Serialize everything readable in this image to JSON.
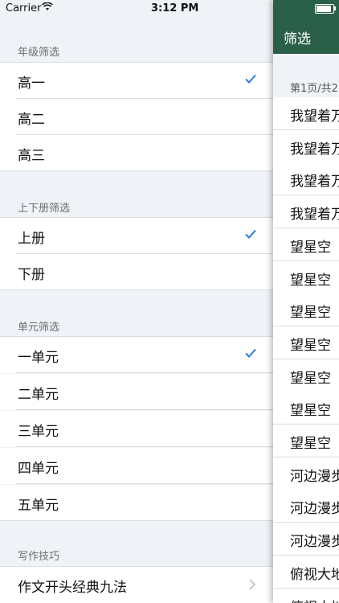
{
  "status_bar": {
    "carrier": "Carrier",
    "time": "3:12 PM"
  },
  "filter": {
    "sections": [
      {
        "header": "年级筛选",
        "items": [
          {
            "label": "高一",
            "checked": true
          },
          {
            "label": "高二",
            "checked": false
          },
          {
            "label": "高三",
            "checked": false
          }
        ]
      },
      {
        "header": "上下册筛选",
        "items": [
          {
            "label": "上册",
            "checked": true
          },
          {
            "label": "下册",
            "checked": false
          }
        ]
      },
      {
        "header": "单元筛选",
        "items": [
          {
            "label": "一单元",
            "checked": true
          },
          {
            "label": "二单元",
            "checked": false
          },
          {
            "label": "三单元",
            "checked": false
          },
          {
            "label": "四单元",
            "checked": false
          },
          {
            "label": "五单元",
            "checked": false
          }
        ]
      },
      {
        "header": "写作技巧",
        "items": [
          {
            "label": "作文开头经典九法",
            "checked": false
          }
        ]
      }
    ]
  },
  "main": {
    "nav_title": "筛选",
    "page_info": "第1页/共2",
    "items": [
      "我望着万",
      "我望着万",
      "我望着万",
      "我望着万",
      "望星空",
      "望星空",
      "望星空",
      "望星空",
      "望星空",
      "望星空",
      "望星空",
      "河边漫步",
      "河边漫步",
      "河边漫步",
      "俯视大地",
      "俯视大地"
    ]
  },
  "colors": {
    "accent_check": "#2f7bd9",
    "navbar_green": "#2a6049",
    "group_bg": "#eff2f7"
  }
}
